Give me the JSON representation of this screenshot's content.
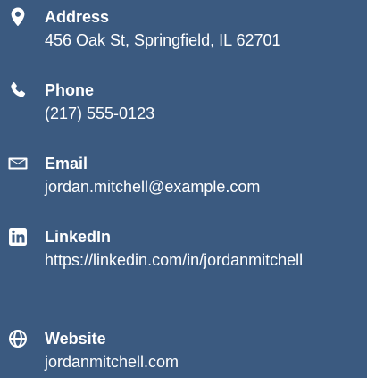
{
  "contacts": [
    {
      "label": "Address",
      "value": "456 Oak St, Springfield, IL 62701",
      "icon": "map-pin-icon"
    },
    {
      "label": "Phone",
      "value": "(217) 555-0123",
      "icon": "phone-icon"
    },
    {
      "label": "Email",
      "value": "jordan.mitchell@example.com",
      "icon": "envelope-icon"
    },
    {
      "label": "LinkedIn",
      "value": "https://linkedin.com/in/jordanmitchell",
      "icon": "linkedin-icon"
    },
    {
      "label": "Website",
      "value": "jordanmitchell.com",
      "icon": "globe-icon"
    }
  ],
  "colors": {
    "background": "#3b5a80",
    "text": "#ffffff"
  }
}
